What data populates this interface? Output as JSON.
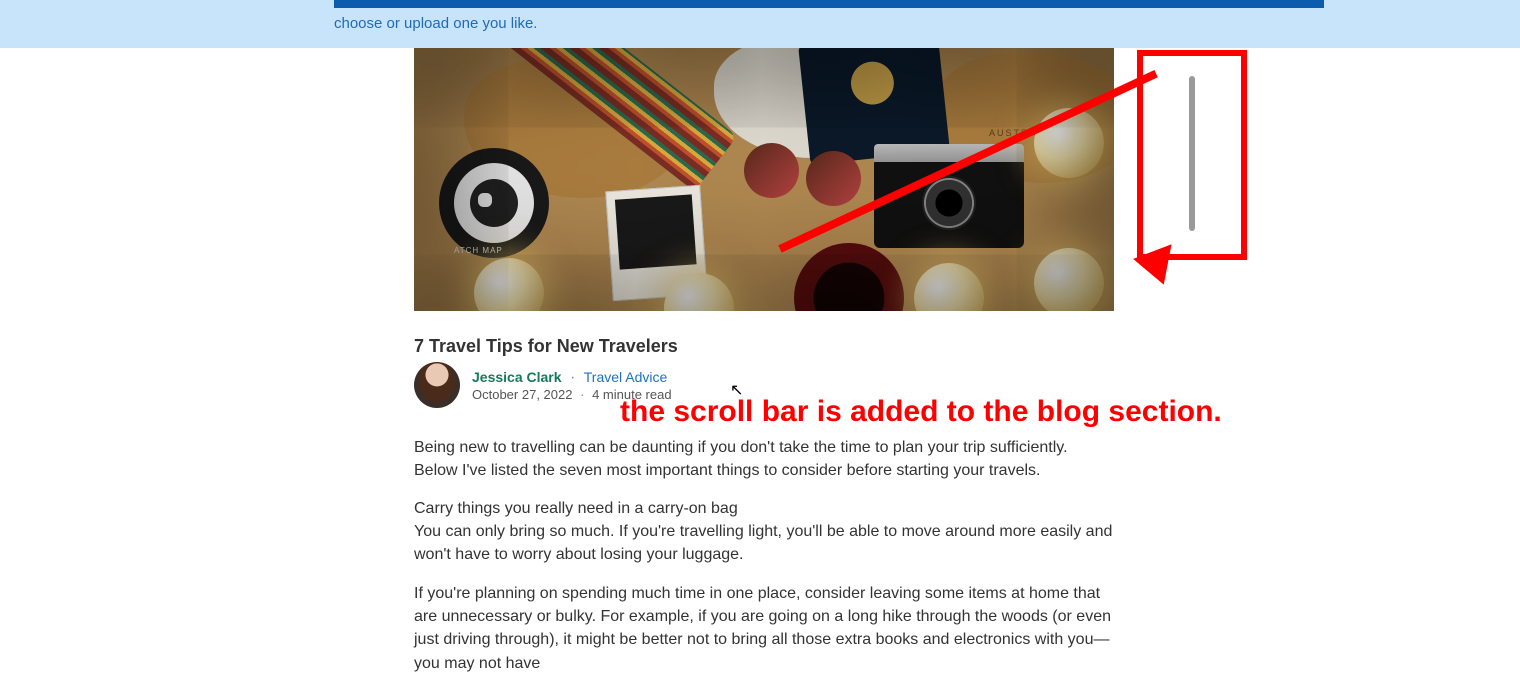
{
  "banner": {
    "text": "choose or upload one you like."
  },
  "post": {
    "title": "7 Travel Tips for New Travelers",
    "author": "Jessica Clark",
    "category": "Travel Advice",
    "date": "October 27, 2022",
    "read_time": "4 minute read",
    "hero_alt": "Scratch world map with passport, camera, sunglasses, mug and string lights",
    "map_label": "AUSTRALIA",
    "patch_label": "ATCH MAP",
    "body": {
      "p1": "Being new to travelling can be daunting if you don't take the time to plan your trip sufficiently. Below I've listed the seven most important things to consider before starting your travels.",
      "p2_heading": "Carry things you really need in a carry-on bag",
      "p2": "You can only bring so much. If you're travelling light, you'll be able to move around more easily and won't have to worry about losing your luggage.",
      "p3": "If you're planning on spending much time in one place, consider leaving some items at home that are unnecessary or bulky. For example, if you are going on a long hike through the woods (or even just driving through), it might be better not to bring all those extra books and electronics with you—you may not have"
    }
  },
  "annotation": {
    "text": "the scroll bar is added to the blog section."
  },
  "separator": "·"
}
